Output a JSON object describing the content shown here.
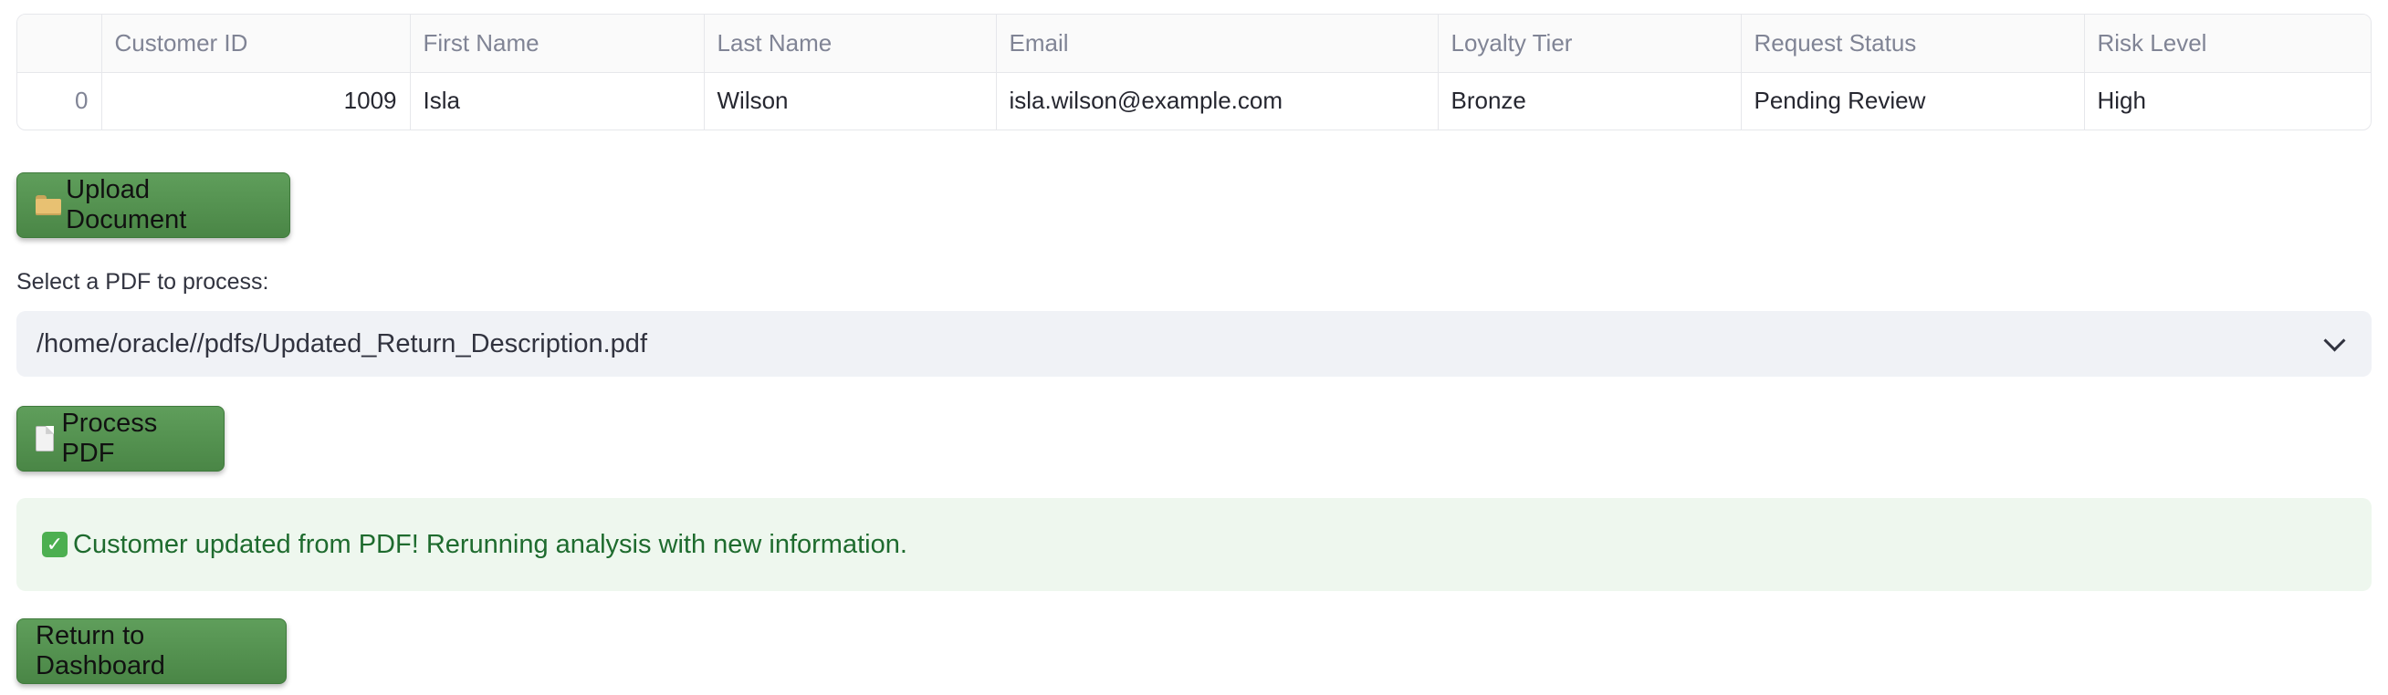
{
  "table": {
    "columns": [
      "",
      "Customer ID",
      "First Name",
      "Last Name",
      "Email",
      "Loyalty Tier",
      "Request Status",
      "Risk Level"
    ],
    "rows": [
      [
        "0",
        "1009",
        "Isla",
        "Wilson",
        "isla.wilson@example.com",
        "Bronze",
        "Pending Review",
        "High"
      ]
    ]
  },
  "upload_button": {
    "label": "Upload Document",
    "icon": "folder-icon"
  },
  "pdf_select": {
    "label": "Select a PDF to process:",
    "value": "/home/oracle//pdfs/Updated_Return_Description.pdf"
  },
  "process_button": {
    "label": "Process PDF",
    "icon": "page-icon"
  },
  "success_alert": {
    "text": "Customer updated from PDF! Rerunning analysis with new information.",
    "icon": "check-icon"
  },
  "return_button": {
    "label": "Return to Dashboard"
  },
  "colors": {
    "button_green": "#4f8d4b",
    "alert_bg": "#eef7ee",
    "alert_text": "#1e6b2e",
    "select_bg": "#f0f2f6"
  }
}
